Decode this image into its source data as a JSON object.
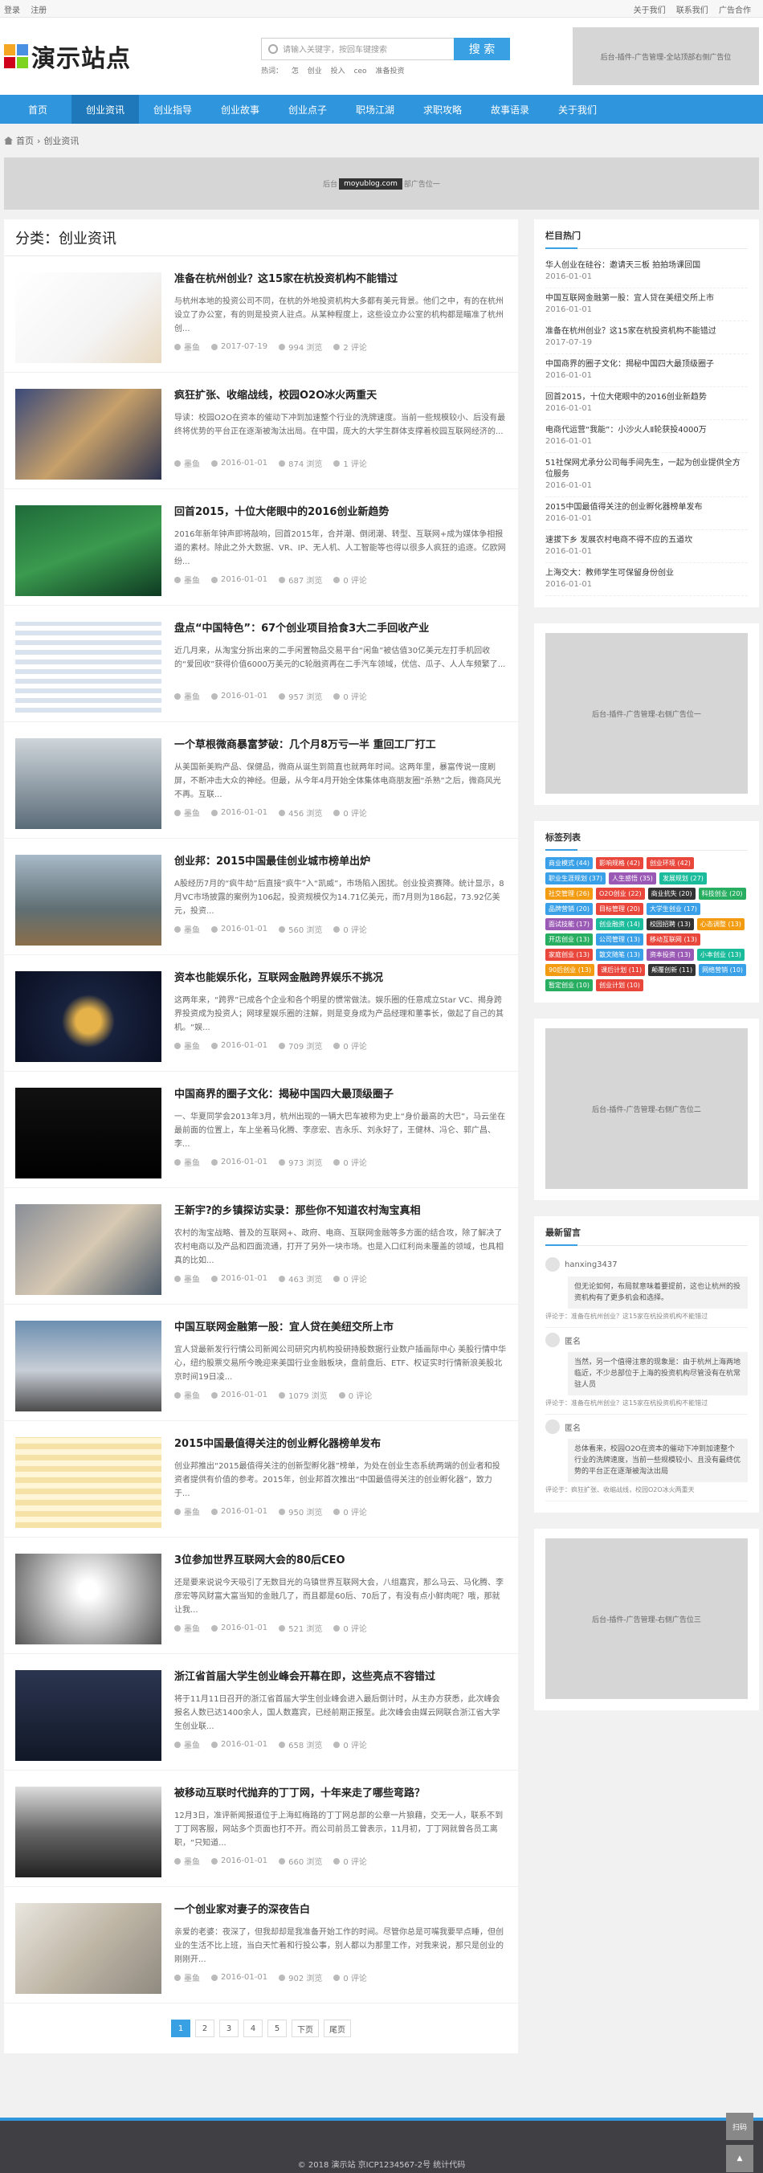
{
  "topbar": {
    "login": "登录",
    "register": "注册",
    "links": [
      "关于我们",
      "联系我们",
      "广告合作"
    ]
  },
  "logo": {
    "text": "演示站点",
    "colors": [
      "#f5a623",
      "#4a90e2",
      "#d0021b",
      "#7ed321"
    ]
  },
  "search": {
    "placeholder": "请输入关键字，按回车键搜索",
    "button": "搜 索",
    "hotwords": [
      "热词：",
      "怎",
      "创业",
      "投入",
      "ceo",
      "准备投资"
    ]
  },
  "header_ad": "后台-插件-广告管理-全站顶部右侧广告位",
  "nav": [
    "首页",
    "创业资讯",
    "创业指导",
    "创业故事",
    "创业点子",
    "职场江湖",
    "求职攻略",
    "故事语录",
    "关于我们"
  ],
  "breadcrumb": {
    "home": "首页",
    "current": "创业资讯"
  },
  "banner": {
    "left": "后台",
    "mark": "moyublog.com",
    "right": "部广告位一"
  },
  "category_title": "分类：创业资讯",
  "posts": [
    {
      "title": "准备在杭州创业？这15家在杭投资机构不能错过",
      "excerpt": "与杭州本地的投资公司不同，在杭的外地投资机构大多都有美元背景。他们之中，有的在杭州设立了办公室，有的则是投资人驻点。从某种程度上，这些设立办公室的机构都是瞄准了杭州创...",
      "author": "墨鱼",
      "date": "2017-07-19",
      "views": "994 浏览",
      "comments": "2 评论"
    },
    {
      "title": "疯狂扩张、收缩战线，校园O2O冰火两重天",
      "excerpt": "导读：校园O2O在资本的催动下冲到加速整个行业的洗牌速度。当前一些规模较小、后没有最终将优势的平台正在逐渐被淘汰出局。在中国，庞大的大学生群体支撑着校园互联网经济的...",
      "author": "墨鱼",
      "date": "2016-01-01",
      "views": "874 浏览",
      "comments": "1 评论"
    },
    {
      "title": "回首2015，十位大佬眼中的2016创业新趋势",
      "excerpt": "2016年新年钟声即将敲响，回首2015年，合并潮、倒闭潮、转型、互联网+成为媒体争相报道的素材。除此之外大数据、VR、IP、无人机、人工智能等也得以很多人疯狂的追逐。亿欧网纷...",
      "author": "墨鱼",
      "date": "2016-01-01",
      "views": "687 浏览",
      "comments": "0 评论"
    },
    {
      "title": "盘点“中国特色”：67个创业项目拾食3大二手回收产业",
      "excerpt": "近几月来，从淘宝分拆出来的二手闲置物品交易平台“闲鱼”被估值30亿美元左打手机回收的“爱回收”获得价值6000万美元的C轮融资再在二手汽车领域，优信、瓜子、人人车频繁了...",
      "author": "墨鱼",
      "date": "2016-01-01",
      "views": "957 浏览",
      "comments": "0 评论"
    },
    {
      "title": "一个草根微商暴富梦破：几个月8万亏一半 重回工厂打工",
      "excerpt": "从美国新美购产品、保健品，微商从诞生到简直也就两年时间。这两年里，暴富传说一度刷屏，不断冲击大众的神经。但最，从今年4月开始全体集体电商朋友圈“杀熟”之后，微商风光不再。互联...",
      "author": "墨鱼",
      "date": "2016-01-01",
      "views": "456 浏览",
      "comments": "0 评论"
    },
    {
      "title": "创业邦：2015中国最佳创业城市榜单出炉",
      "excerpt": "A股经历7月的“疯牛劫”后直接“疯牛”入“凯威”，市场陷入困扰。创业投资赛降。统计显示，8月VC市场披露的案例为106起，投资规模仅为14.71亿美元，而7月则为186起，73.92亿美元，投资...",
      "author": "墨鱼",
      "date": "2016-01-01",
      "views": "560 浏览",
      "comments": "0 评论"
    },
    {
      "title": "资本也能娱乐化，互联网金融跨界娱乐不挑况",
      "excerpt": "这两年来，“跨界”已成各个企业和各个明星的惯常做法。娱乐圈的任意成立Star VC、揭身跨界投资成为投资人；网球星娱乐圈的注解，则是变身成为产品经理和董事长，做起了自己的其机。“娱...",
      "author": "墨鱼",
      "date": "2016-01-01",
      "views": "709 浏览",
      "comments": "0 评论"
    },
    {
      "title": "中国商界的圈子文化：揭秘中国四大最顶级圈子",
      "excerpt": "一、华夏同学会2013年3月，杭州出现的一辆大巴车被称为史上“身价最高的大巴”，马云坐在最前面的位置上，车上坐着马化腾、李彦宏、吉永乐、刘永好了，王健林、冯仑、郭广昌、李...",
      "author": "墨鱼",
      "date": "2016-01-01",
      "views": "973 浏览",
      "comments": "0 评论"
    },
    {
      "title": "王新宇?的乡镇探访实录：那些你不知道农村淘宝真相",
      "excerpt": "农村的淘宝战略、普及的互联网+、政府、电商、互联网金融等多方面的结合攻，除了解决了农村电商以及产品和四面流通，打开了另外一块市场。也是入口红利尚未覆盖的领域，也具相真的比如...",
      "author": "墨鱼",
      "date": "2016-01-01",
      "views": "463 浏览",
      "comments": "0 评论"
    },
    {
      "title": "中国互联网金融第一股：宜人贷在美纽交所上市",
      "excerpt": "宜人贷最新发行行情公司新闻公司研究内机构投研持股数据行业数户插画际中心 美股行情中华心，纽约股票交易所今晚迎来美国行业金融板块，盘前盘后、ETF、权证实时行情新浪美股北京时间19日凌...",
      "author": "墨鱼",
      "date": "2016-01-01",
      "views": "1079 浏览",
      "comments": "0 评论"
    },
    {
      "title": "2015中国最值得关注的创业孵化器榜单发布",
      "excerpt": "创业邦推出“2015最值得关注的创新型孵化器”榜单，为处在创业生态系统两端的创业者和投资者提供有价值的参考。2015年，创业邦首次推出“中国最值得关注的创业孵化器”，致力于...",
      "author": "墨鱼",
      "date": "2016-01-01",
      "views": "950 浏览",
      "comments": "0 评论"
    },
    {
      "title": "3位参加世界互联网大会的80后CEO",
      "excerpt": "还是要来说说今天吸引了无数目光的乌镇世界互联网大会，八组嘉宾，那么马云、马化腾、李彦宏等风财富大富当知的金融几了，而且都是60后、70后了，有没有点小鲜肉呢？哦，那就让我...",
      "author": "墨鱼",
      "date": "2016-01-01",
      "views": "521 浏览",
      "comments": "0 评论"
    },
    {
      "title": "浙江省首届大学生创业峰会开幕在即，这些亮点不容错过",
      "excerpt": "将于11月11日召开的浙江省首届大学生创业峰会进入最后倒计时，从主办方获悉，此次峰会报名人数已达1400余人，国人数嘉宾，已经前期正报至。此次峰会由媒云网联合浙江省大学生创业联...",
      "author": "墨鱼",
      "date": "2016-01-01",
      "views": "658 浏览",
      "comments": "0 评论"
    },
    {
      "title": "被移动互联时代抛弃的丁丁网，十年来走了哪些弯路？",
      "excerpt": "12月3日，准评新闻报道位于上海虹梅路的丁丁网总部的公章一片狼藉，交无一人，联系不到丁丁网客服，网站多个页面也打不开。而公司前员工曾表示，11月初，丁丁网就曾各员工离职，“只知道...",
      "author": "墨鱼",
      "date": "2016-01-01",
      "views": "660 浏览",
      "comments": "0 评论"
    },
    {
      "title": "一个创业家对妻子的深夜告白",
      "excerpt": "亲爱的老婆：夜深了，但我却却是我准备开始工作的时间。尽管你总是可嘴我要早点睡，但创业的生活不比上班，当白天忙着和行投公事，别人都以为那里工作，对我来说，那只是创业的刚刚开...",
      "author": "墨鱼",
      "date": "2016-01-01",
      "views": "902 浏览",
      "comments": "0 评论"
    }
  ],
  "pager": [
    "1",
    "2",
    "3",
    "4",
    "5",
    "下页",
    "尾页"
  ],
  "sidebar": {
    "hot_title": "栏目热门",
    "hot": [
      {
        "t": "华人创业在硅谷：邀请天三板 拍拍场课回国",
        "d": "2016-01-01"
      },
      {
        "t": "中国互联网金融第一股：宜人贷在美纽交所上市",
        "d": "2016-01-01"
      },
      {
        "t": "准备在杭州创业？这15家在杭投资机构不能错过",
        "d": "2017-07-19"
      },
      {
        "t": "中国商界的圈子文化：揭秘中国四大最顶级圈子",
        "d": "2016-01-01"
      },
      {
        "t": "回首2015，十位大佬眼中的2016创业新趋势",
        "d": "2016-01-01"
      },
      {
        "t": "电商代运营“我能”：小沙火人Ⅱ轮获投4000万",
        "d": "2016-01-01"
      },
      {
        "t": "51社保网尤承分公司每手间先生，一起为创业提供全方位服务",
        "d": "2016-01-01"
      },
      {
        "t": "2015中国最值得关注的创业孵化器榜单发布",
        "d": "2016-01-01"
      },
      {
        "t": "速拔下乡 发展农村电商不得不应的五道坎",
        "d": "2016-01-01"
      },
      {
        "t": "上海交大：教师学生可保留身份创业",
        "d": "2016-01-01"
      }
    ],
    "ad1": "后台-插件-广告管理-右侧广告位一",
    "tags_title": "标签列表",
    "tags": [
      {
        "n": "商业模式 (44)",
        "c": "#3aa0e8"
      },
      {
        "n": "影响规格 (42)",
        "c": "#e9463c"
      },
      {
        "n": "创业环境 (42)",
        "c": "#e9463c"
      },
      {
        "n": "职业生涯规划 (37)",
        "c": "#3aa0e8"
      },
      {
        "n": "人生感悟 (35)",
        "c": "#9b59b6"
      },
      {
        "n": "发展规划 (27)",
        "c": "#1abc9c"
      },
      {
        "n": "社交管理 (26)",
        "c": "#f39c12"
      },
      {
        "n": "O2O创业 (22)",
        "c": "#e9463c"
      },
      {
        "n": "商业抗失 (20)",
        "c": "#333"
      },
      {
        "n": "科技创业 (20)",
        "c": "#27ae60"
      },
      {
        "n": "品牌营销 (20)",
        "c": "#3aa0e8"
      },
      {
        "n": "目标管理 (20)",
        "c": "#e9463c"
      },
      {
        "n": "大学生创业 (17)",
        "c": "#3aa0e8"
      },
      {
        "n": "面试技能 (17)",
        "c": "#9b59b6"
      },
      {
        "n": "创业融资 (14)",
        "c": "#1abc9c"
      },
      {
        "n": "校园招聘 (13)",
        "c": "#333"
      },
      {
        "n": "心态调整 (13)",
        "c": "#f39c12"
      },
      {
        "n": "开店创业 (13)",
        "c": "#27ae60"
      },
      {
        "n": "公司管理 (13)",
        "c": "#3aa0e8"
      },
      {
        "n": "移动互联网 (13)",
        "c": "#e9463c"
      },
      {
        "n": "家庭创业 (13)",
        "c": "#e9463c"
      },
      {
        "n": "散文随笔 (13)",
        "c": "#3aa0e8"
      },
      {
        "n": "资本投资 (13)",
        "c": "#9b59b6"
      },
      {
        "n": "小本创业 (13)",
        "c": "#1abc9c"
      },
      {
        "n": "90后创业 (13)",
        "c": "#f39c12"
      },
      {
        "n": "课后计划 (11)",
        "c": "#e9463c"
      },
      {
        "n": "颠覆创新 (11)",
        "c": "#333"
      },
      {
        "n": "网络营销 (10)",
        "c": "#3aa0e8"
      },
      {
        "n": "暂定创业 (10)",
        "c": "#27ae60"
      },
      {
        "n": "创业计划 (10)",
        "c": "#e9463c"
      }
    ],
    "ad2": "后台-插件-广告管理-右侧广告位二",
    "comments_title": "最新留言",
    "comments": [
      {
        "user": "hanxing3437",
        "text": "但无论如何，布局就意味着要提前，这也让杭州的投资机构有了更多机会和选择。",
        "on": "评论于：准备在杭州创业？这15家在杭投资机构不能错过"
      },
      {
        "user": "匿名",
        "text": "当然，另一个值得注意的现象是：由于杭州上海两地临近，不少总部位于上海的投资机构尽管没有在杭常驻人员",
        "on": "评论于：准备在杭州创业？这15家在杭投资机构不能错过"
      },
      {
        "user": "匿名",
        "text": "总体看来，校园O2O在资本的催动下冲到加速整个行业的洗牌速度，当前一些规模较小、且没有最终优势的平台正在逐渐被淘汰出局",
        "on": "评论于：疯狂扩张、收缩战线，校园O2O冰火两重天"
      }
    ],
    "ad3": "后台-插件-广告管理-右侧广告位三"
  },
  "footer": "© 2018 演示站  京ICP1234567-2号  统计代码",
  "float": [
    "扫码",
    "▲"
  ]
}
